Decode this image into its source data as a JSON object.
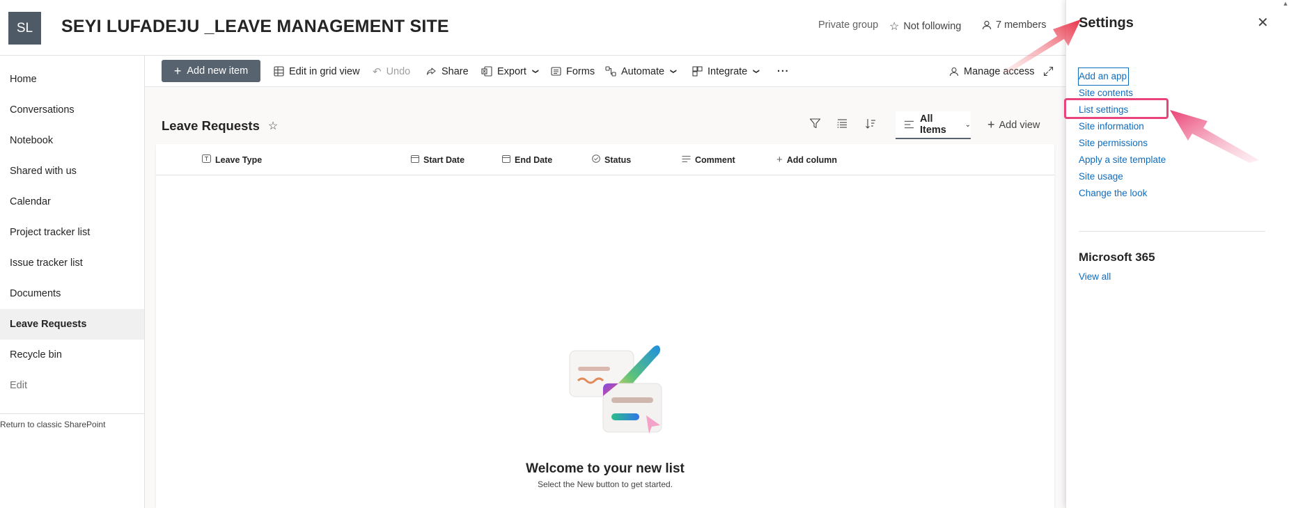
{
  "header": {
    "logo_initials": "SL",
    "site_title": "SEYI LUFADEJU _LEAVE MANAGEMENT SITE",
    "privacy": "Private group",
    "follow_label": "Not following",
    "members_label": "7 members"
  },
  "leftnav": {
    "items": [
      {
        "label": "Home"
      },
      {
        "label": "Conversations"
      },
      {
        "label": "Notebook"
      },
      {
        "label": "Shared with us"
      },
      {
        "label": "Calendar"
      },
      {
        "label": "Project tracker list"
      },
      {
        "label": "Issue tracker list"
      },
      {
        "label": "Documents"
      },
      {
        "label": "Leave Requests"
      },
      {
        "label": "Recycle bin"
      },
      {
        "label": "Edit"
      }
    ],
    "classic_link": "Return to classic SharePoint"
  },
  "commandbar": {
    "new_item": "Add new item",
    "grid_view": "Edit in grid view",
    "undo": "Undo",
    "share": "Share",
    "export": "Export",
    "forms": "Forms",
    "automate": "Automate",
    "integrate": "Integrate",
    "more": "···",
    "manage_access": "Manage access"
  },
  "list": {
    "title": "Leave Requests",
    "view_name": "All Items",
    "add_view": "Add view",
    "columns": [
      {
        "label": "Leave Type"
      },
      {
        "label": "Start Date"
      },
      {
        "label": "End Date"
      },
      {
        "label": "Status"
      },
      {
        "label": "Comment"
      },
      {
        "label": "Add column"
      }
    ],
    "empty_title": "Welcome to your new list",
    "empty_subtitle": "Select the New button to get started."
  },
  "settings_panel": {
    "title": "Settings",
    "links": [
      {
        "label": "Add an app"
      },
      {
        "label": "Site contents"
      },
      {
        "label": "List settings"
      },
      {
        "label": "Site information"
      },
      {
        "label": "Site permissions"
      },
      {
        "label": "Apply a site template"
      },
      {
        "label": "Site usage"
      },
      {
        "label": "Change the look"
      }
    ],
    "ms365_title": "Microsoft 365",
    "view_all": "View all"
  },
  "colors": {
    "accent_link": "#0f6cbd",
    "primary_button": "#57646f",
    "annotation_highlight": "#e8437a",
    "annotation_arrow": "#e8334a"
  }
}
